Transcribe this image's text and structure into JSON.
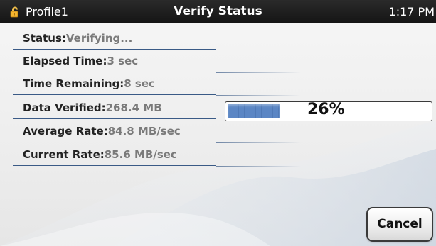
{
  "topbar": {
    "profile": "Profile1",
    "title": "Verify Status",
    "time": "1:17 PM",
    "lock_icon": "unlocked-padlock-icon"
  },
  "rows": [
    {
      "label": "Status",
      "value": "Verifying..."
    },
    {
      "label": "Elapsed Time",
      "value": "3 sec"
    },
    {
      "label": "Time Remaining",
      "value": "8 sec"
    },
    {
      "label": "Data Verified",
      "value": "268.4 MB"
    },
    {
      "label": "Average Rate",
      "value": "84.8 MB/sec"
    },
    {
      "label": "Current Rate",
      "value": "85.6 MB/sec"
    }
  ],
  "progress": {
    "percent_text": "26%",
    "fraction": 0.26,
    "fill_color": "#5b86c4"
  },
  "buttons": {
    "cancel": "Cancel"
  },
  "colors": {
    "topbar_bg": "#1b1b1b",
    "row_divider": "#3a5a86",
    "value_text": "#7a7a7a",
    "label_text": "#222222"
  }
}
